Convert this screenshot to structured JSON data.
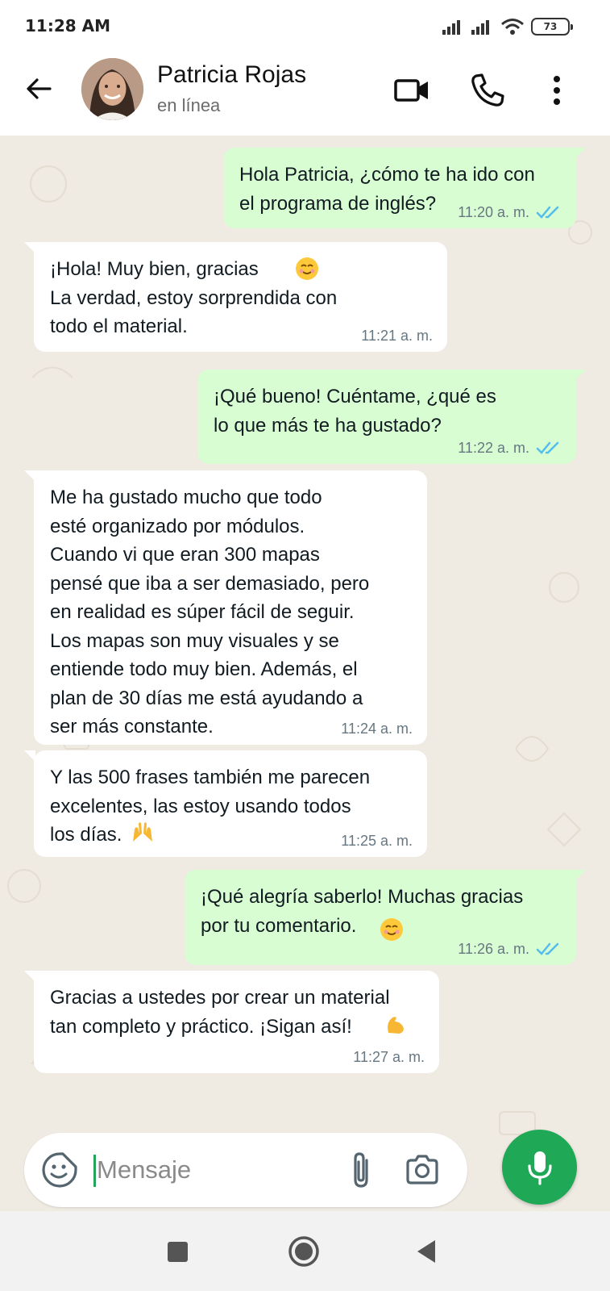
{
  "status_bar": {
    "time": "11:28 AM",
    "battery": "73",
    "icons": [
      "signal-icon",
      "signal-icon",
      "wifi-icon",
      "battery-icon"
    ]
  },
  "header": {
    "name": "Patricia Rojas",
    "status": "en línea",
    "icons": [
      "back-arrow-icon",
      "avatar",
      "video-call-icon",
      "phone-icon",
      "more-vertical-icon"
    ]
  },
  "messages": [
    {
      "direction": "out",
      "text": "Hola Patricia, ¿cómo te ha ido con\nel programa de inglés?",
      "time": "11:20 a. m.",
      "read": true
    },
    {
      "direction": "in",
      "text": "¡Hola! Muy bien, gracias\nLa verdad, estoy sorprendida con\ntodo el material.",
      "emoji": "smiling-face-emoji",
      "time": "11:21 a. m."
    },
    {
      "direction": "out",
      "text": "¡Qué bueno! Cuéntame, ¿qué es\nlo que más te ha gustado?",
      "time": "11:22 a. m.",
      "read": true
    },
    {
      "direction": "in",
      "text": "Me ha gustado mucho que todo\nesté organizado por módulos.\nCuando vi que eran 300 mapas\npensé que iba a ser demasiado, pero\nen realidad es súper fácil de seguir.\nLos mapas son muy visuales y se\nentiende todo muy bien. Además, el\nplan de 30 días me está ayudando a\nser más constante.",
      "time": "11:24 a. m."
    },
    {
      "direction": "in",
      "text": "Y las 500 frases también me parecen\nexcelentes, las estoy usando todos\nlos días.",
      "emoji": "raising-hands-emoji",
      "time": "11:25 a. m."
    },
    {
      "direction": "out",
      "text": "¡Qué alegría saberlo! Muchas gracias\npor tu comentario.",
      "emoji": "smiling-face-emoji",
      "time": "11:26 a. m.",
      "read": true
    },
    {
      "direction": "in",
      "text": "Gracias a ustedes por crear un material\ntan completo y práctico. ¡Sigan así!",
      "emoji": "flexed-biceps-emoji",
      "time": "11:27 a. m."
    }
  ],
  "composer": {
    "placeholder": "Mensaje",
    "icons": [
      "emoji-sticker-icon",
      "paperclip-icon",
      "camera-icon",
      "microphone-icon"
    ]
  },
  "nav_bar": {
    "icons": [
      "recents-square-icon",
      "home-circle-icon",
      "back-triangle-icon"
    ]
  },
  "colors": {
    "outgoing_bubble": "#d9fdd3",
    "incoming_bubble": "#ffffff",
    "chat_background": "#efeae2",
    "accent_green": "#1fa855",
    "read_ticks": "#53bdeb"
  }
}
